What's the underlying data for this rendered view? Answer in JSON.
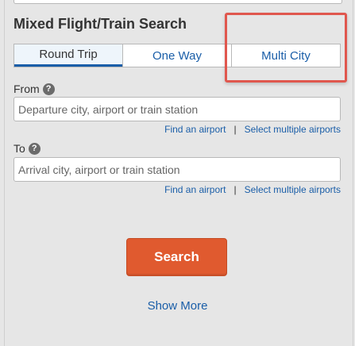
{
  "section": {
    "title": "Mixed Flight/Train Search"
  },
  "tabs": [
    {
      "label": "Round Trip",
      "active": true
    },
    {
      "label": "One Way",
      "active": false
    },
    {
      "label": "Multi City",
      "active": false
    }
  ],
  "from": {
    "label": "From",
    "help_icon": "?",
    "placeholder": "Departure city, airport or train station",
    "value": "",
    "link_find": "Find an airport",
    "separator": "|",
    "link_multiple": "Select multiple airports"
  },
  "to": {
    "label": "To",
    "help_icon": "?",
    "placeholder": "Arrival city, airport or train station",
    "value": "",
    "link_find": "Find an airport",
    "separator": "|",
    "link_multiple": "Select multiple airports"
  },
  "search_button": {
    "label": "Search"
  },
  "show_more": {
    "label": "Show More"
  },
  "colors": {
    "accent_blue": "#1a5ea8",
    "search_orange": "#e05a2f",
    "highlight_red": "#e0574e",
    "background": "#e6e6e6"
  }
}
